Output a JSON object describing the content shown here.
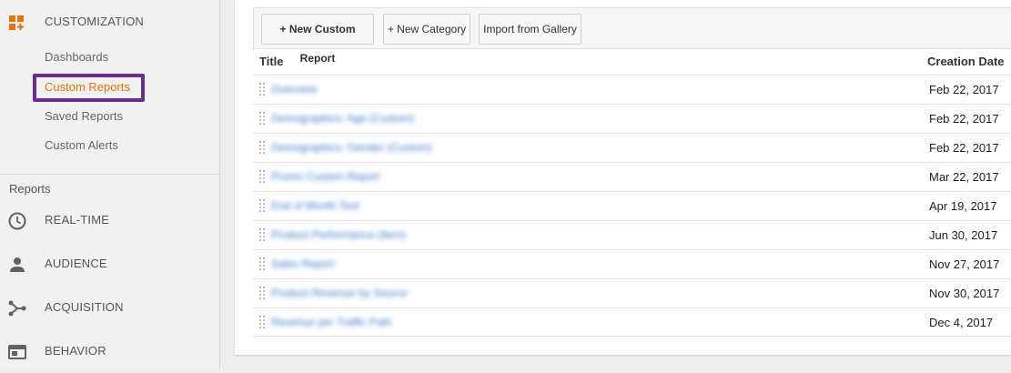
{
  "sidebar": {
    "customization": {
      "label": "CUSTOMIZATION",
      "icon": "customization-grid-icon",
      "items": [
        {
          "label": "Dashboards",
          "active": false
        },
        {
          "label": "Custom Reports",
          "active": true
        },
        {
          "label": "Saved Reports",
          "active": false
        },
        {
          "label": "Custom Alerts",
          "active": false
        }
      ]
    },
    "reports_title": "Reports",
    "nav": [
      {
        "label": "REAL-TIME",
        "icon": "clock-icon"
      },
      {
        "label": "AUDIENCE",
        "icon": "person-icon"
      },
      {
        "label": "ACQUISITION",
        "icon": "acquisition-icon"
      },
      {
        "label": "BEHAVIOR",
        "icon": "behavior-icon"
      }
    ]
  },
  "toolbar": {
    "new_report": "+ New Custom Report",
    "new_category": "+ New Category",
    "import_gallery": "Import from Gallery"
  },
  "table": {
    "headers": {
      "title": "Title",
      "date": "Creation Date"
    },
    "rows": [
      {
        "title": "Overview",
        "date": "Feb 22, 2017"
      },
      {
        "title": "Demographics: Age (Custom)",
        "date": "Feb 22, 2017"
      },
      {
        "title": "Demographics: Gender (Custom)",
        "date": "Feb 22, 2017"
      },
      {
        "title": "Promo Custom Report",
        "date": "Mar 22, 2017"
      },
      {
        "title": "End of Month Test",
        "date": "Apr 19, 2017"
      },
      {
        "title": "Product Performance (Item)",
        "date": "Jun 30, 2017"
      },
      {
        "title": "Sales Report",
        "date": "Nov 27, 2017"
      },
      {
        "title": "Product Revenue by Source",
        "date": "Nov 30, 2017"
      },
      {
        "title": "Revenue per Traffic Path",
        "date": "Dec 4, 2017"
      }
    ]
  },
  "colors": {
    "accent": "#e8710a",
    "highlight": "#6a2c8e",
    "link": "#3b78c9"
  }
}
